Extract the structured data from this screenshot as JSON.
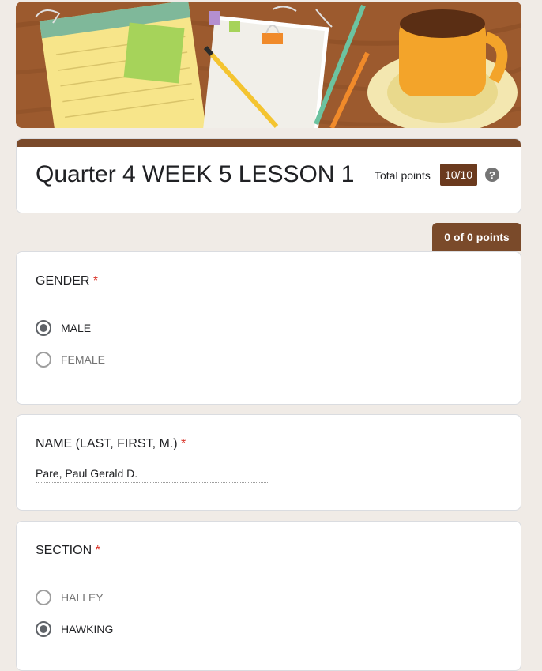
{
  "form": {
    "title": "Quarter 4 WEEK 5 LESSON 1",
    "total_points_label": "Total points",
    "total_points_value": "10/10",
    "help_glyph": "?",
    "section_points": "0 of 0 points"
  },
  "questions": [
    {
      "title": "GENDER",
      "required_mark": "*",
      "options": [
        {
          "label": "MALE",
          "selected": true
        },
        {
          "label": "FEMALE",
          "selected": false
        }
      ]
    },
    {
      "title": "NAME (LAST, FIRST, M.)",
      "required_mark": "*",
      "answer": "Pare, Paul Gerald D."
    },
    {
      "title": "SECTION",
      "required_mark": "*",
      "options": [
        {
          "label": "HALLEY",
          "selected": false
        },
        {
          "label": "HAWKING",
          "selected": true
        }
      ]
    }
  ],
  "colors": {
    "accent": "#7a4a2a",
    "badge": "#6b3a1e",
    "required": "#d93025",
    "background": "#f0ebe6"
  },
  "icons": {
    "help": "help-icon",
    "radio_checked": "radio-checked-icon",
    "radio_unchecked": "radio-unchecked-icon"
  }
}
